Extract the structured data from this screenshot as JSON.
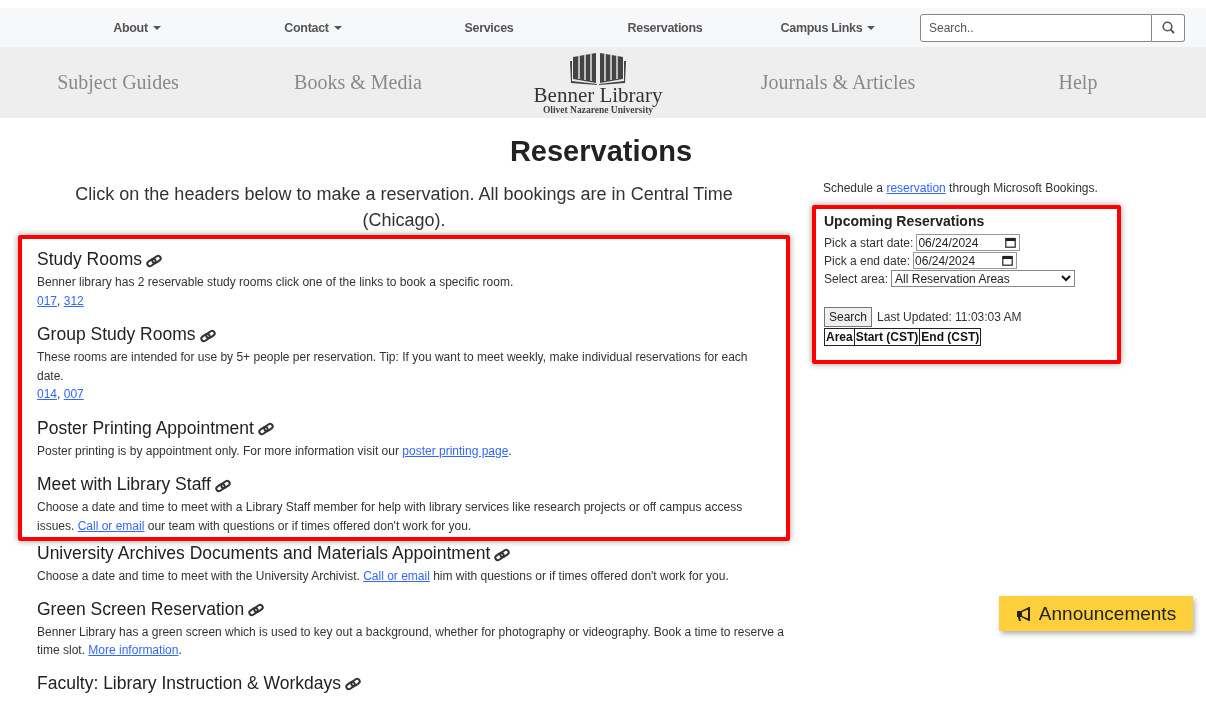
{
  "nav": {
    "items": [
      {
        "label": "About",
        "dropdown": true
      },
      {
        "label": "Contact",
        "dropdown": true
      },
      {
        "label": "Services",
        "dropdown": false
      },
      {
        "label": "Reservations",
        "dropdown": false
      },
      {
        "label": "Campus Links",
        "dropdown": true
      }
    ],
    "search": {
      "placeholder": "Search.."
    }
  },
  "subnav": {
    "items": [
      {
        "kind": "link",
        "label": "Subject Guides"
      },
      {
        "kind": "link",
        "label": "Books & Media"
      },
      {
        "kind": "logo",
        "title": "Benner Library",
        "subtitle": "Olivet Nazarene University"
      },
      {
        "kind": "link",
        "label": "Journals & Articles"
      },
      {
        "kind": "link",
        "label": "Help"
      }
    ]
  },
  "page": {
    "title": "Reservations",
    "intro": "Click on the headers below to make a reservation. All bookings are in Central Time (Chicago)."
  },
  "sections": [
    {
      "title": "Study Rooms",
      "highlighted": true,
      "paragraphs": [
        [
          {
            "text": "Benner library has 2 reservable study rooms click one of the links to book a specific room."
          }
        ],
        [
          {
            "link": "017"
          },
          {
            "text": ", "
          },
          {
            "link": "312"
          }
        ]
      ]
    },
    {
      "title": "Group Study Rooms",
      "highlighted": true,
      "paragraphs": [
        [
          {
            "text": "These rooms are intended for use by 5+ people per reservation. Tip: If you want to meet weekly, make individual reservations for each date."
          }
        ],
        [
          {
            "link": "014"
          },
          {
            "text": ", "
          },
          {
            "link": "007"
          }
        ]
      ]
    },
    {
      "title": "Poster Printing Appointment",
      "highlighted": true,
      "paragraphs": [
        [
          {
            "text": "Poster printing is by appointment only. For more information visit our "
          },
          {
            "link": "poster printing page"
          },
          {
            "text": "."
          }
        ]
      ]
    },
    {
      "title": "Meet with Library Staff",
      "highlighted": true,
      "paragraphs": [
        [
          {
            "text": "Choose a date and time to meet with a Library Staff member for help with library services like research projects or off campus access issues. "
          },
          {
            "link": "Call or email"
          },
          {
            "text": " our team with questions or if times offered don't work for you."
          }
        ]
      ]
    },
    {
      "title": "University Archives Documents and Materials Appointment",
      "highlighted": false,
      "paragraphs": [
        [
          {
            "text": "Choose a date and time to meet with the University Archivist. "
          },
          {
            "link": "Call or email"
          },
          {
            "text": " him with questions or if times offered don't work for you."
          }
        ]
      ]
    },
    {
      "title": "Green Screen Reservation",
      "highlighted": false,
      "paragraphs": [
        [
          {
            "text": "Benner Library has a green screen which is used to key out a background, whether for photography or videography. Book a time to reserve a time slot. "
          },
          {
            "link": "More information"
          },
          {
            "text": "."
          }
        ]
      ]
    },
    {
      "title": "Faculty: Library Instruction & Workdays",
      "highlighted": false
    }
  ],
  "sidebar": {
    "intro": [
      {
        "text": "Schedule a "
      },
      {
        "link": "reservation"
      },
      {
        "text": " through Microsoft Bookings."
      }
    ],
    "upcoming": {
      "highlighted": true,
      "title": "Upcoming Reservations",
      "start_label": "Pick a start date:",
      "start_value": "06/24/2024",
      "end_label": "Pick a end date:",
      "end_value": "06/24/2024",
      "area_label": "Select area:",
      "area_value": "All Reservation Areas",
      "search_button": "Search",
      "last_updated": "Last Updated: 11:03:03 AM",
      "columns": [
        "Area",
        "Start (CST)",
        "End (CST)"
      ]
    }
  },
  "announcements": {
    "label": "Announcements"
  }
}
